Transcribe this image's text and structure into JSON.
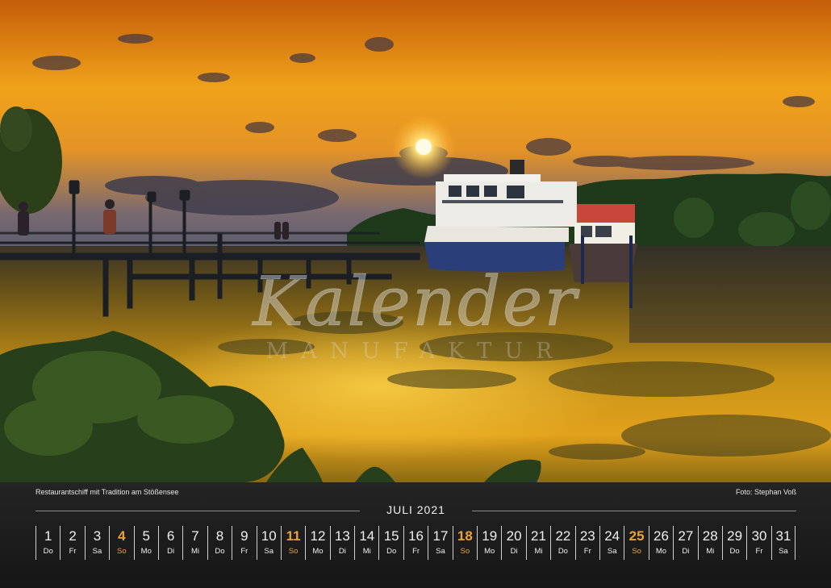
{
  "photo": {
    "subject": "sunset-lake-restaurant-ship",
    "watermark": {
      "script_text": "Kalender",
      "sub_text": "MANUFAKTUR"
    }
  },
  "calendar": {
    "caption_left": "Restaurantschiff mit Tradition am Stößensee",
    "caption_right": "Foto: Stephan Voß",
    "month_title": "JULI 2021",
    "highlight_color": "#e9a33c",
    "days": [
      {
        "num": "1",
        "wd": "Do",
        "sunday": false
      },
      {
        "num": "2",
        "wd": "Fr",
        "sunday": false
      },
      {
        "num": "3",
        "wd": "Sa",
        "sunday": false
      },
      {
        "num": "4",
        "wd": "So",
        "sunday": true
      },
      {
        "num": "5",
        "wd": "Mo",
        "sunday": false
      },
      {
        "num": "6",
        "wd": "Di",
        "sunday": false
      },
      {
        "num": "7",
        "wd": "Mi",
        "sunday": false
      },
      {
        "num": "8",
        "wd": "Do",
        "sunday": false
      },
      {
        "num": "9",
        "wd": "Fr",
        "sunday": false
      },
      {
        "num": "10",
        "wd": "Sa",
        "sunday": false
      },
      {
        "num": "11",
        "wd": "So",
        "sunday": true
      },
      {
        "num": "12",
        "wd": "Mo",
        "sunday": false
      },
      {
        "num": "13",
        "wd": "Di",
        "sunday": false
      },
      {
        "num": "14",
        "wd": "Mi",
        "sunday": false
      },
      {
        "num": "15",
        "wd": "Do",
        "sunday": false
      },
      {
        "num": "16",
        "wd": "Fr",
        "sunday": false
      },
      {
        "num": "17",
        "wd": "Sa",
        "sunday": false
      },
      {
        "num": "18",
        "wd": "So",
        "sunday": true
      },
      {
        "num": "19",
        "wd": "Mo",
        "sunday": false
      },
      {
        "num": "20",
        "wd": "Di",
        "sunday": false
      },
      {
        "num": "21",
        "wd": "Mi",
        "sunday": false
      },
      {
        "num": "22",
        "wd": "Do",
        "sunday": false
      },
      {
        "num": "23",
        "wd": "Fr",
        "sunday": false
      },
      {
        "num": "24",
        "wd": "Sa",
        "sunday": false
      },
      {
        "num": "25",
        "wd": "So",
        "sunday": true
      },
      {
        "num": "26",
        "wd": "Mo",
        "sunday": false
      },
      {
        "num": "27",
        "wd": "Di",
        "sunday": false
      },
      {
        "num": "28",
        "wd": "Mi",
        "sunday": false
      },
      {
        "num": "29",
        "wd": "Do",
        "sunday": false
      },
      {
        "num": "30",
        "wd": "Fr",
        "sunday": false
      },
      {
        "num": "31",
        "wd": "Sa",
        "sunday": false
      }
    ]
  }
}
